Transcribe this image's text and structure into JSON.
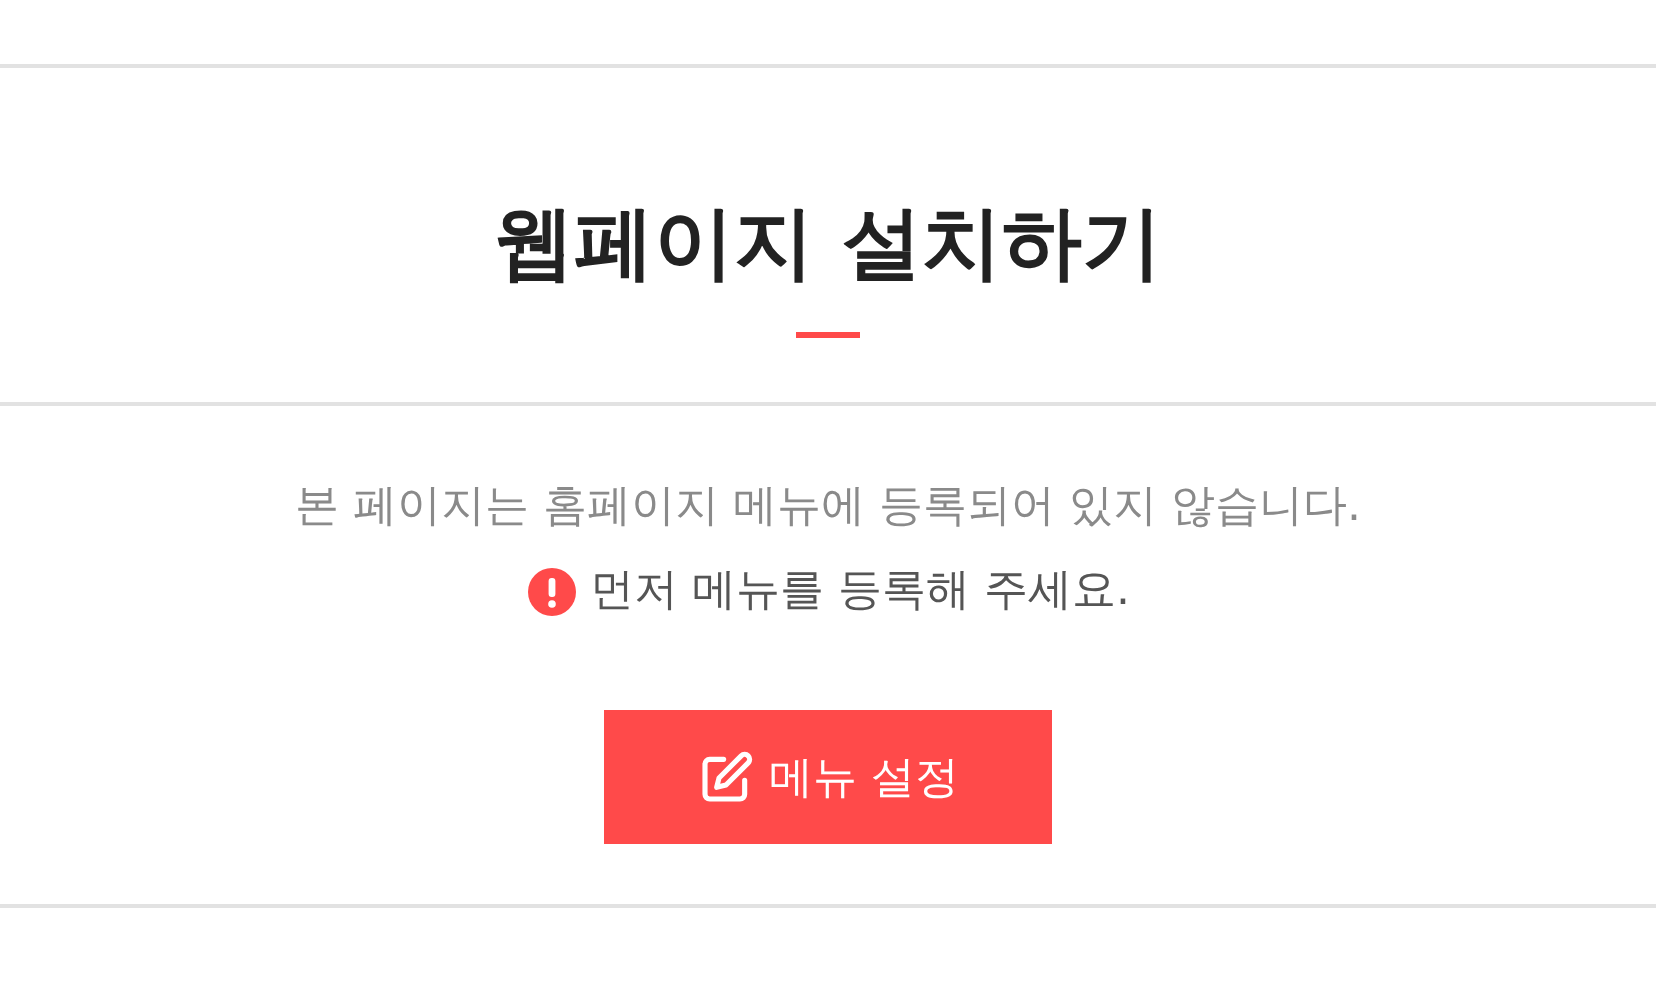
{
  "title": "웹페이지 설치하기",
  "notices": [
    {
      "kind": "info",
      "text": "본 페이지는 홈페이지 메뉴에 등록되어 있지 않습니다."
    },
    {
      "kind": "warning",
      "text": "먼저 메뉴를 등록해 주세요."
    }
  ],
  "button": {
    "label": "메뉴 설정"
  }
}
